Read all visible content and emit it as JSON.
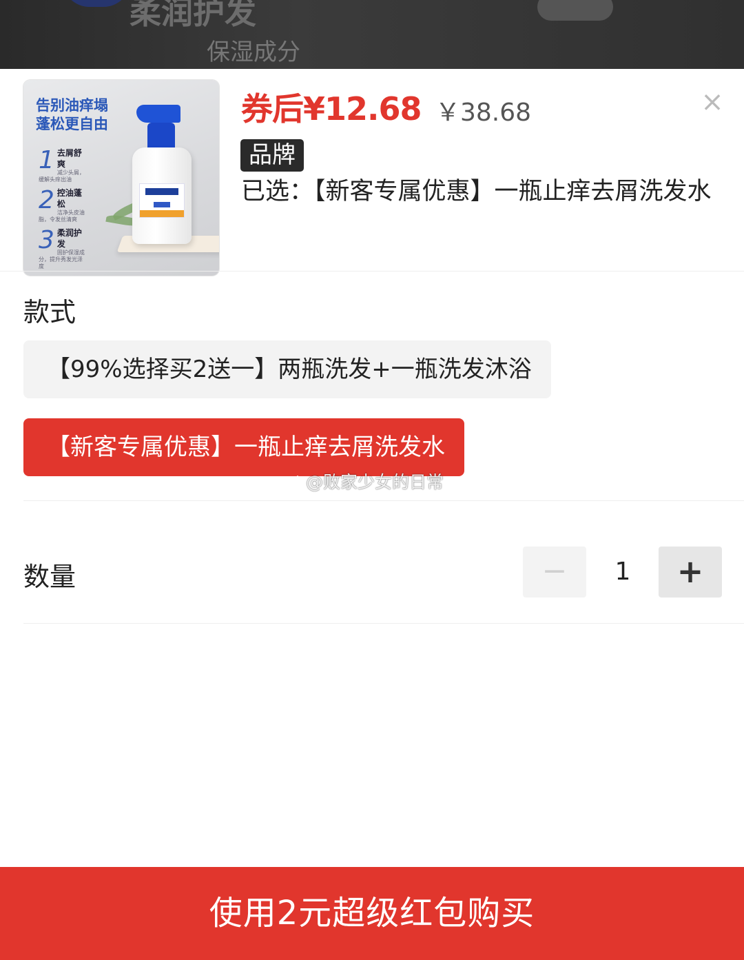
{
  "backdrop": {
    "partial_text_1": "柔润护发",
    "partial_text_2": "保湿成分"
  },
  "product_image": {
    "headline_line1": "告别油痒塌",
    "headline_line2": "蓬松更自由",
    "features": [
      {
        "num": "1",
        "title": "去屑舒爽",
        "desc": "减少头屑，缓解头痒出油"
      },
      {
        "num": "2",
        "title": "控油蓬松",
        "desc": "洁净头皮油脂，令发丝清爽"
      },
      {
        "num": "3",
        "title": "柔润护发",
        "desc": "固护保湿成分，提升秀发光泽度"
      }
    ]
  },
  "price": {
    "coupon_price": "券后¥12.68",
    "original_price": "￥38.68"
  },
  "brand_badge": "品牌",
  "selected": "已选：【新客专属优惠】一瓶止痒去屑洗发水",
  "style_section": {
    "title": "款式",
    "options": [
      {
        "label": "【99%选择买2送一】两瓶洗发+一瓶洗发沐浴",
        "active": false
      },
      {
        "label": "【新客专属优惠】一瓶止痒去屑洗发水",
        "active": true
      }
    ]
  },
  "watermark": "@败家少女的日常",
  "quantity": {
    "title": "数量",
    "minus": "−",
    "value": "1",
    "plus": "+"
  },
  "buy_button": "使用2元超级红包购买",
  "colors": {
    "accent": "#e1362d",
    "brand_badge_bg": "#2a2a2a"
  }
}
